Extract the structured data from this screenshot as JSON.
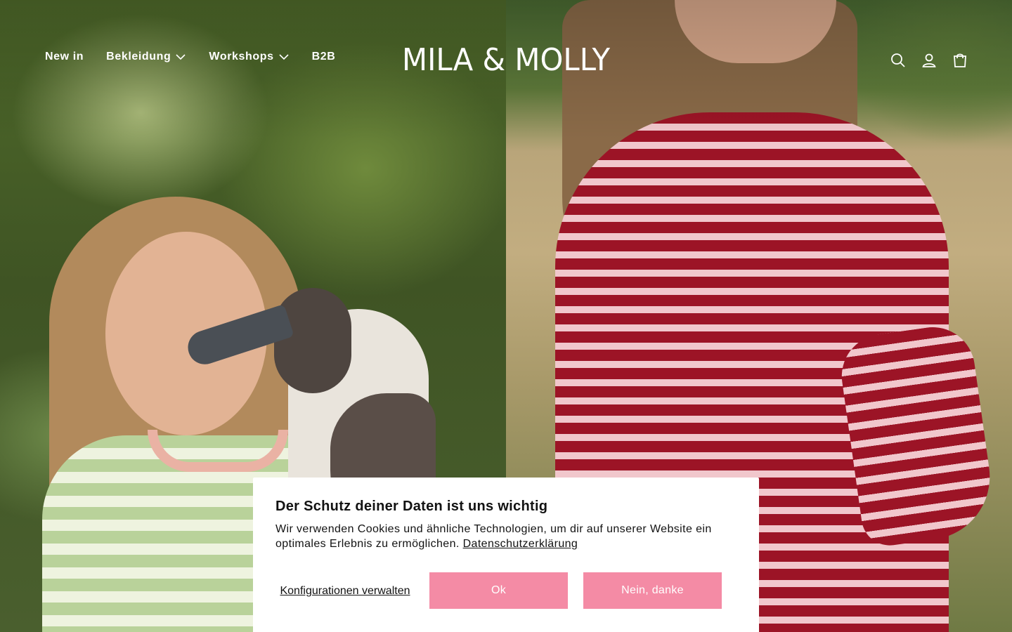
{
  "header": {
    "nav": [
      {
        "label": "New in",
        "has_dropdown": false
      },
      {
        "label": "Bekleidung",
        "has_dropdown": true
      },
      {
        "label": "Workshops",
        "has_dropdown": true
      },
      {
        "label": "B2B",
        "has_dropdown": false
      }
    ],
    "logo_text": "MILA & MOLLY",
    "icons": [
      "search-icon",
      "account-icon",
      "cart-icon"
    ]
  },
  "cookie_banner": {
    "title": "Der Schutz deiner Daten ist uns wichtig",
    "text": "Wir verwenden Cookies und ähnliche Technologien, um dir auf unserer Website ein optimales Erlebnis zu ermöglichen.",
    "link_label": "Datenschutzerklärung",
    "config_label": "Konfigurationen verwalten",
    "ok_label": "Ok",
    "decline_label": "Nein, danke"
  },
  "colors": {
    "button_pink": "#f48ba5",
    "text": "#121212",
    "header_text": "#ffffff"
  }
}
